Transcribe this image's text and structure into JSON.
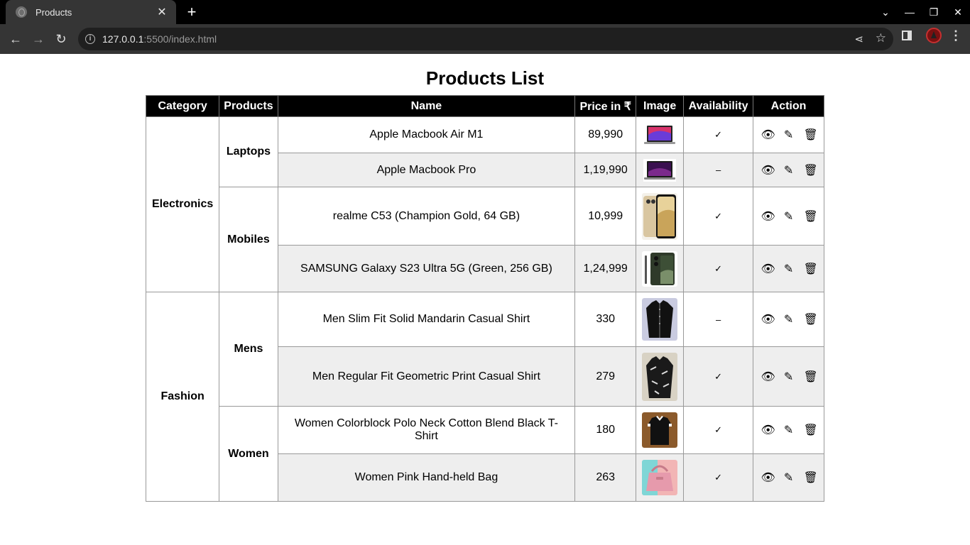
{
  "browser": {
    "tab_title": "Products",
    "url_host": "127.0.0.1",
    "url_rest": ":5500/index.html"
  },
  "page": {
    "title": "Products List"
  },
  "table": {
    "headers": [
      "Category",
      "Products",
      "Name",
      "Price in ₹",
      "Image",
      "Availability",
      "Action"
    ],
    "categories": [
      {
        "label": "Electronics"
      },
      {
        "label": "Fashion"
      }
    ],
    "product_groups": [
      {
        "label": "Laptops"
      },
      {
        "label": "Mobiles"
      },
      {
        "label": "Mens"
      },
      {
        "label": "Women"
      }
    ],
    "rows": [
      {
        "name": "Apple Macbook Air M1",
        "price": "89,990",
        "availability": "✓",
        "image_icon": "laptop-air-image"
      },
      {
        "name": "Apple Macbook Pro",
        "price": "1,19,990",
        "availability": "–",
        "image_icon": "laptop-pro-image"
      },
      {
        "name": "realme C53 (Champion Gold, 64 GB)",
        "price": "10,999",
        "availability": "✓",
        "image_icon": "phone-gold-image"
      },
      {
        "name": "SAMSUNG Galaxy S23 Ultra 5G (Green, 256 GB)",
        "price": "1,24,999",
        "availability": "✓",
        "image_icon": "phone-green-image"
      },
      {
        "name": "Men Slim Fit Solid Mandarin Casual Shirt",
        "price": "330",
        "availability": "–",
        "image_icon": "shirt-black-image"
      },
      {
        "name": "Men Regular Fit Geometric Print Casual Shirt",
        "price": "279",
        "availability": "✓",
        "image_icon": "shirt-print-image"
      },
      {
        "name": "Women Colorblock Polo Neck Cotton Blend Black T-Shirt",
        "price": "180",
        "availability": "✓",
        "image_icon": "tshirt-image"
      },
      {
        "name": "Women Pink Hand-held Bag",
        "price": "263",
        "availability": "✓",
        "image_icon": "bag-image"
      }
    ]
  },
  "actions": {
    "view_icon": "eye-icon",
    "edit_icon": "pencil-icon",
    "delete_icon": "trash-icon"
  },
  "colors": {
    "header_bg": "#000000",
    "alt_row_bg": "#eeeeee",
    "chrome_bg": "#353535"
  }
}
